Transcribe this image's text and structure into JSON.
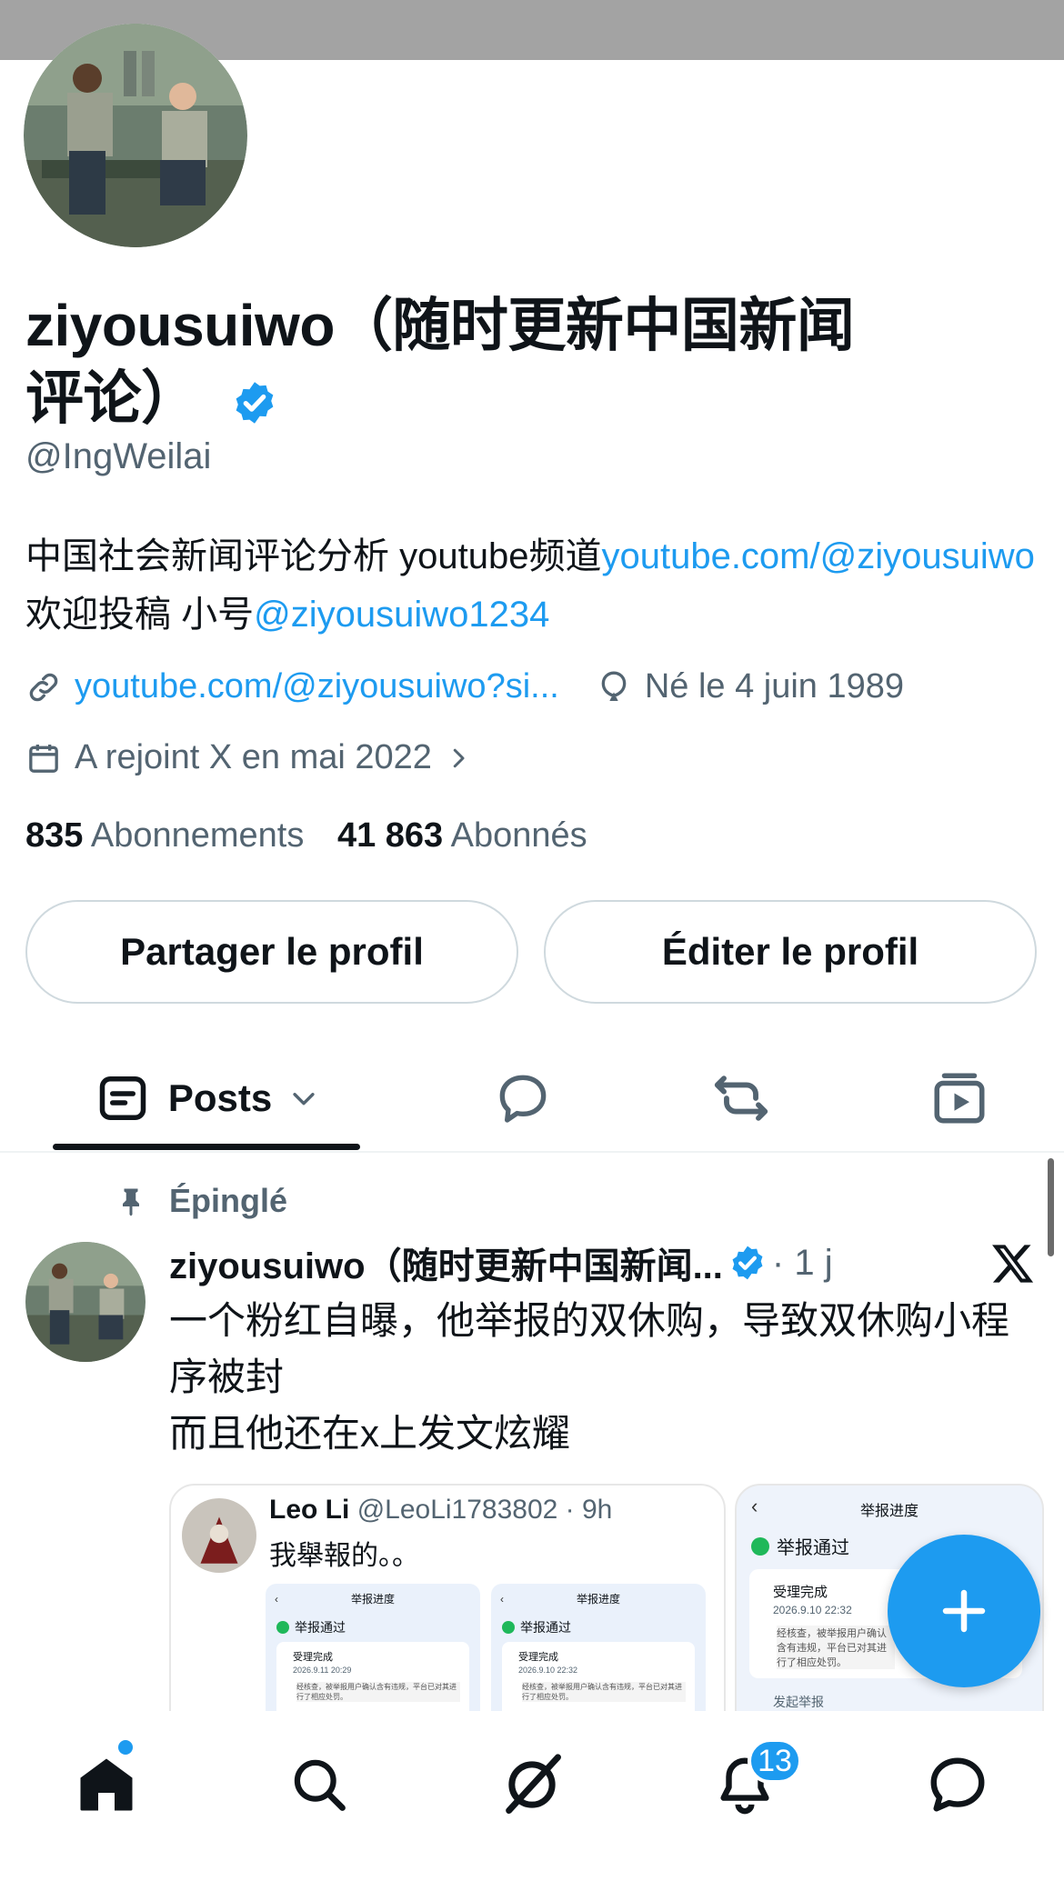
{
  "profile": {
    "display_name": "ziyousuiwo（随时更新中国新闻评论）",
    "handle": "@IngWeilai",
    "bio": {
      "text1": "中国社会新闻评论分析 youtube频道",
      "link1": "youtube.com/@ziyousuiwo",
      "text2": " 欢迎投稿 小号",
      "link2": "@ziyousuiwo1234"
    },
    "website": "youtube.com/@ziyousuiwo?si...",
    "birth": "Né le 4 juin 1989",
    "joined": "A rejoint X en mai 2022",
    "following_count": "835",
    "following_label": "Abonnements",
    "followers_count": "41 863",
    "followers_label": "Abonnés"
  },
  "buttons": {
    "share": "Partager le profil",
    "edit": "Éditer le profil"
  },
  "tabs": {
    "posts": "Posts"
  },
  "pinned_post": {
    "pinned_label": "Épinglé",
    "author": "ziyousuiwo（随时更新中国新闻...",
    "time": "· 1 j",
    "text_line1": "一个粉红自曝，他举报的双休购，导致双休购小程序被封",
    "text_line2": "而且他还在x上发文炫耀",
    "media": {
      "quoted_name": "Leo Li",
      "quoted_handle": "@LeoLi1783802 · 9h",
      "quoted_text": "我舉報的。。",
      "panel_title": "举报进度",
      "status": "举报通过",
      "step1": "受理完成",
      "date1": "2026.9.11 20:29",
      "date2": "2026.9.10 22:32",
      "detail": "经核查，被举报用户确认含有违规，平台已对其进行了相应处罚。",
      "detail_short": "经核查，被举报用户确认含有违规，平台已对其进行了相应处罚。",
      "step2": "发起举报"
    }
  },
  "nav": {
    "notif_count": "13"
  },
  "colors": {
    "accent": "#1d9bf0",
    "text": "#0f1419",
    "muted": "#536471"
  }
}
